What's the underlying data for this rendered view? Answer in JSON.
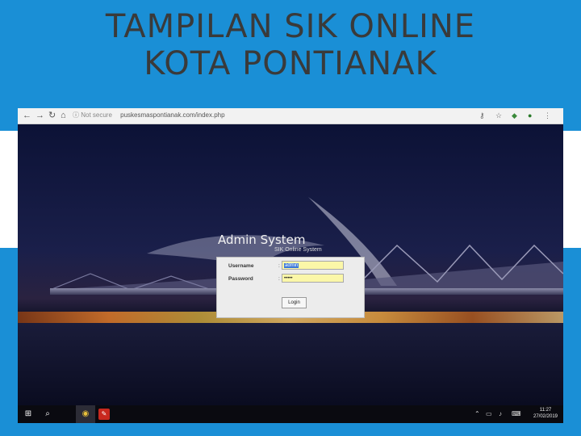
{
  "slide": {
    "title_line1": "TAMPILAN SIK ONLINE",
    "title_line2": "KOTA PONTIANAK",
    "colors": {
      "background": "#1a8fd6",
      "band": "#ffffff",
      "title": "#3a3a3a"
    }
  },
  "browser": {
    "nav_icons": [
      "back-arrow-icon",
      "forward-arrow-icon",
      "reload-icon",
      "home-icon"
    ],
    "security_text": "Not secure",
    "url": "puskesmaspontianak.com/index.php",
    "toolbar_icons": [
      "key-icon",
      "star-icon",
      "extension-icon",
      "account-icon",
      "menu-icon"
    ]
  },
  "login": {
    "title": "Admin System",
    "subtitle": "SIK Online System",
    "username_label": "Username",
    "username_value": "admin",
    "password_label": "Password",
    "password_value": "•••••",
    "colon": ":",
    "button_label": "Login",
    "field_color": "#fbf7a8"
  },
  "taskbar": {
    "icons": [
      "windows-start-icon",
      "search-icon",
      "chrome-icon",
      "pdf-app-icon"
    ],
    "tray_icons": [
      "chevron-up-icon",
      "network-icon",
      "volume-icon",
      "keyboard-icon"
    ],
    "time": "11:27",
    "date": "27/02/2019"
  }
}
